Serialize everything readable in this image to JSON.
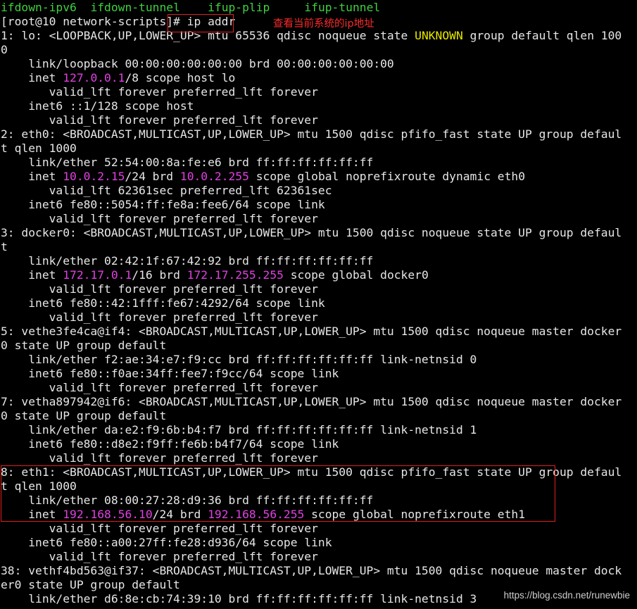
{
  "terminal": {
    "lines": [
      [
        {
          "t": "ifdown-ipv6  ",
          "c": "green"
        },
        {
          "t": "ifdown-tunnel",
          "c": "green"
        },
        {
          "t": "    ",
          "c": "default"
        },
        {
          "t": "ifup-plip",
          "c": "green"
        },
        {
          "t": "     ",
          "c": "default"
        },
        {
          "t": "ifup-tunnel",
          "c": "green"
        }
      ],
      [
        {
          "t": "[root@10 network-scripts]# ip addr",
          "c": "default"
        }
      ],
      [
        {
          "t": "1: lo: <LOOPBACK,UP,LOWER_UP> mtu 65536 qdisc noqueue state ",
          "c": "default"
        },
        {
          "t": "UNKNOWN",
          "c": "yellow"
        },
        {
          "t": " group default qlen 100",
          "c": "default"
        }
      ],
      [
        {
          "t": "0",
          "c": "default"
        }
      ],
      [
        {
          "t": "    link/loopback 00:00:00:00:00:00 brd 00:00:00:00:00:00",
          "c": "default"
        }
      ],
      [
        {
          "t": "    inet ",
          "c": "default"
        },
        {
          "t": "127.0.0.1",
          "c": "magenta"
        },
        {
          "t": "/8 scope host lo",
          "c": "default"
        }
      ],
      [
        {
          "t": "       valid_lft forever preferred_lft forever",
          "c": "default"
        }
      ],
      [
        {
          "t": "    inet6 ::1/128 scope host",
          "c": "default"
        }
      ],
      [
        {
          "t": "       valid_lft forever preferred_lft forever",
          "c": "default"
        }
      ],
      [
        {
          "t": "2: eth0: <BROADCAST,MULTICAST,UP,LOWER_UP> mtu 1500 qdisc pfifo_fast state UP group defaul",
          "c": "default"
        }
      ],
      [
        {
          "t": "t qlen 1000",
          "c": "default"
        }
      ],
      [
        {
          "t": "    link/ether 52:54:00:8a:fe:e6 brd ff:ff:ff:ff:ff:ff",
          "c": "default"
        }
      ],
      [
        {
          "t": "    inet ",
          "c": "default"
        },
        {
          "t": "10.0.2.15",
          "c": "magenta"
        },
        {
          "t": "/24 brd ",
          "c": "default"
        },
        {
          "t": "10.0.2.255",
          "c": "magenta"
        },
        {
          "t": " scope global noprefixroute dynamic eth0",
          "c": "default"
        }
      ],
      [
        {
          "t": "       valid_lft 62361sec preferred_lft 62361sec",
          "c": "default"
        }
      ],
      [
        {
          "t": "    inet6 fe80::5054:ff:fe8a:fee6/64 scope link",
          "c": "default"
        }
      ],
      [
        {
          "t": "       valid_lft forever preferred_lft forever",
          "c": "default"
        }
      ],
      [
        {
          "t": "3: docker0: <BROADCAST,MULTICAST,UP,LOWER_UP> mtu 1500 qdisc noqueue state UP group defaul",
          "c": "default"
        }
      ],
      [
        {
          "t": "t",
          "c": "default"
        }
      ],
      [
        {
          "t": "    link/ether 02:42:1f:67:42:92 brd ff:ff:ff:ff:ff:ff",
          "c": "default"
        }
      ],
      [
        {
          "t": "    inet ",
          "c": "default"
        },
        {
          "t": "172.17.0.1",
          "c": "magenta"
        },
        {
          "t": "/16 brd ",
          "c": "default"
        },
        {
          "t": "172.17.255.255",
          "c": "magenta"
        },
        {
          "t": " scope global docker0",
          "c": "default"
        }
      ],
      [
        {
          "t": "       valid_lft forever preferred_lft forever",
          "c": "default"
        }
      ],
      [
        {
          "t": "    inet6 fe80::42:1fff:fe67:4292/64 scope link",
          "c": "default"
        }
      ],
      [
        {
          "t": "       valid_lft forever preferred_lft forever",
          "c": "default"
        }
      ],
      [
        {
          "t": "5: vethe3fe4ca@if4: <BROADCAST,MULTICAST,UP,LOWER_UP> mtu 1500 qdisc noqueue master docker",
          "c": "default"
        }
      ],
      [
        {
          "t": "0 state UP group default",
          "c": "default"
        }
      ],
      [
        {
          "t": "    link/ether f2:ae:34:e7:f9:cc brd ff:ff:ff:ff:ff:ff link-netnsid 0",
          "c": "default"
        }
      ],
      [
        {
          "t": "    inet6 fe80::f0ae:34ff:fee7:f9cc/64 scope link",
          "c": "default"
        }
      ],
      [
        {
          "t": "       valid_lft forever preferred_lft forever",
          "c": "default"
        }
      ],
      [
        {
          "t": "7: vetha897942@if6: <BROADCAST,MULTICAST,UP,LOWER_UP> mtu 1500 qdisc noqueue master docker",
          "c": "default"
        }
      ],
      [
        {
          "t": "0 state UP group default",
          "c": "default"
        }
      ],
      [
        {
          "t": "    link/ether da:e2:f9:6b:b4:f7 brd ff:ff:ff:ff:ff:ff link-netnsid 1",
          "c": "default"
        }
      ],
      [
        {
          "t": "    inet6 fe80::d8e2:f9ff:fe6b:b4f7/64 scope link",
          "c": "default"
        }
      ],
      [
        {
          "t": "       valid_lft forever preferred_lft forever",
          "c": "default"
        }
      ],
      [
        {
          "t": "8: eth1: <BROADCAST,MULTICAST,UP,LOWER_UP> mtu 1500 qdisc pfifo_fast state UP group defaul",
          "c": "default"
        }
      ],
      [
        {
          "t": "t qlen 1000",
          "c": "default"
        }
      ],
      [
        {
          "t": "    link/ether 08:00:27:28:d9:36 brd ff:ff:ff:ff:ff:ff",
          "c": "default"
        }
      ],
      [
        {
          "t": "    inet ",
          "c": "default"
        },
        {
          "t": "192.168.56.10",
          "c": "magenta"
        },
        {
          "t": "/24 brd ",
          "c": "default"
        },
        {
          "t": "192.168.56.255",
          "c": "magenta"
        },
        {
          "t": " scope global noprefixroute eth1",
          "c": "default"
        }
      ],
      [
        {
          "t": "       valid_lft forever preferred_lft forever",
          "c": "default"
        }
      ],
      [
        {
          "t": "    inet6 fe80::a00:27ff:fe28:d936/64 scope link",
          "c": "default"
        }
      ],
      [
        {
          "t": "       valid_lft forever preferred_lft forever",
          "c": "default"
        }
      ],
      [
        {
          "t": "38: vethf4bd563@if37: <BROADCAST,MULTICAST,UP,LOWER_UP> mtu 1500 qdisc noqueue master dock",
          "c": "default"
        }
      ],
      [
        {
          "t": "er0 state UP group default",
          "c": "default"
        }
      ],
      [
        {
          "t": "    link/ether d6:8e:cb:74:39:10 brd ff:ff:ff:ff:ff:ff link-netnsid 3",
          "c": "default"
        }
      ]
    ]
  },
  "annotation": {
    "note": "查看当前系统的ip地址"
  },
  "watermark": "https://blog.csdn.net/runewbie",
  "colors": {
    "background": "#000000",
    "text": "#e6e6e6",
    "green": "#40d040",
    "magenta": "#e040e0",
    "yellow": "#e8e800",
    "annotation_red": "#e02020"
  }
}
